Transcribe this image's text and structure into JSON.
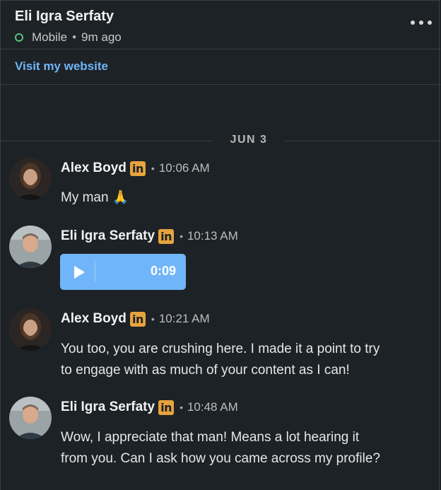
{
  "header": {
    "name": "Eli Igra Serfaty",
    "device": "Mobile",
    "separator": "•",
    "last_active": "9m ago"
  },
  "website": {
    "link_label": "Visit my website"
  },
  "date_divider": "JUN 3",
  "badge_text": "in",
  "meta_separator": "•",
  "messages": [
    {
      "sender": "Alex Boyd",
      "time": "10:06 AM",
      "text": "My man 🙏",
      "avatar": "alex-boyd-avatar"
    },
    {
      "sender": "Eli Igra Serfaty",
      "time": "10:13 AM",
      "audio_duration": "0:09",
      "avatar": "eli-igra-serfaty-avatar"
    },
    {
      "sender": "Alex Boyd",
      "time": "10:21 AM",
      "text_lines": [
        "You too, you are crushing here. I made it a point to try",
        "to engage with as much of your content as I can!"
      ],
      "avatar": "alex-boyd-avatar"
    },
    {
      "sender": "Eli Igra Serfaty",
      "time": "10:48 AM",
      "text_lines": [
        "Wow, I appreciate that man! Means a lot hearing it",
        "from you. Can I ask how you came across my profile?"
      ],
      "avatar": "eli-igra-serfaty-avatar"
    }
  ],
  "colors": {
    "background": "#1d2226",
    "link": "#70b5f9",
    "online": "#57c27e",
    "linkedin_badge": "#e7a33e",
    "audio_player": "#70b5f9"
  },
  "icons": {
    "more": "more-options-icon",
    "presence": "online-status-icon",
    "play": "play-icon",
    "badge": "linkedin-badge-icon"
  }
}
